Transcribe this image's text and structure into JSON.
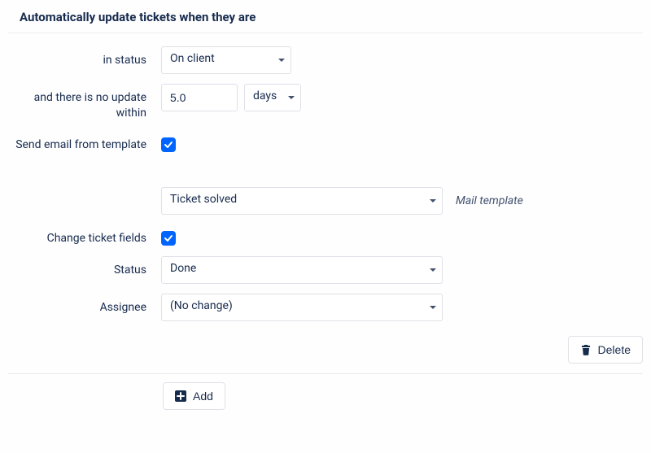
{
  "section_title": "Automatically update tickets when they are",
  "labels": {
    "in_status": "in status",
    "no_update_within": "and there is no update within",
    "send_email": "Send email from template",
    "change_fields": "Change ticket fields",
    "status": "Status",
    "assignee": "Assignee"
  },
  "values": {
    "status_trigger": "On client",
    "duration_value": "5.0",
    "duration_unit": "days",
    "mail_template": "Ticket solved",
    "status_set": "Done",
    "assignee_set": "(No change)"
  },
  "hints": {
    "mail_template": "Mail template"
  },
  "buttons": {
    "delete": "Delete",
    "add": "Add"
  }
}
